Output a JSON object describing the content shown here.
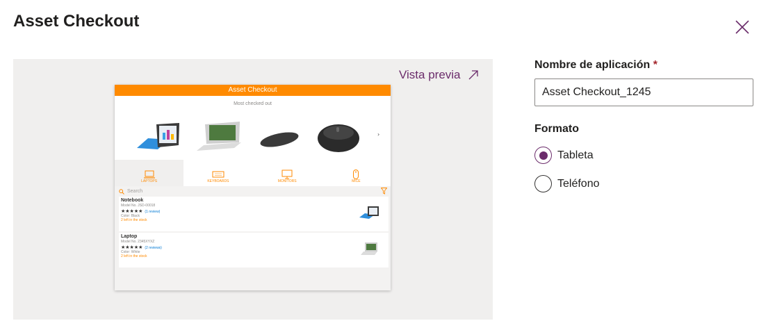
{
  "dialog": {
    "title": "Asset Checkout",
    "close_icon": "close-icon"
  },
  "preview": {
    "link_label": "Vista previa",
    "link_icon": "arrow-up-right-icon",
    "app": {
      "header": "Asset Checkout",
      "subtitle": "Most checked out",
      "accent_color": "#ff8a00",
      "categories": [
        {
          "label": "LAPTOPS",
          "icon": "laptop-icon"
        },
        {
          "label": "KEYBOARDS",
          "icon": "keyboard-icon"
        },
        {
          "label": "MONITORS",
          "icon": "monitor-icon"
        },
        {
          "label": "MICE",
          "icon": "mouse-icon"
        }
      ],
      "search_placeholder": "Search",
      "items": [
        {
          "name": "Notebook",
          "model": "Model No. JSD-00018",
          "stars": "★★★★★",
          "reviews": "(1 review)",
          "color": "Color: Black",
          "stock": "2 left in the stock"
        },
        {
          "name": "Laptop",
          "model": "Model No. 2345XYXZ",
          "stars": "★★★★★",
          "reviews": "(2 reviews)",
          "color": "Color: White",
          "stock": "2 left in the stock"
        }
      ]
    }
  },
  "form": {
    "name_label": "Nombre de aplicación",
    "required_mark": "*",
    "name_value": "Asset Checkout_1245",
    "format_label": "Formato",
    "options": [
      {
        "label": "Tableta",
        "checked": true
      },
      {
        "label": "Teléfono",
        "checked": false
      }
    ],
    "accent_color": "#6b2c6b"
  }
}
